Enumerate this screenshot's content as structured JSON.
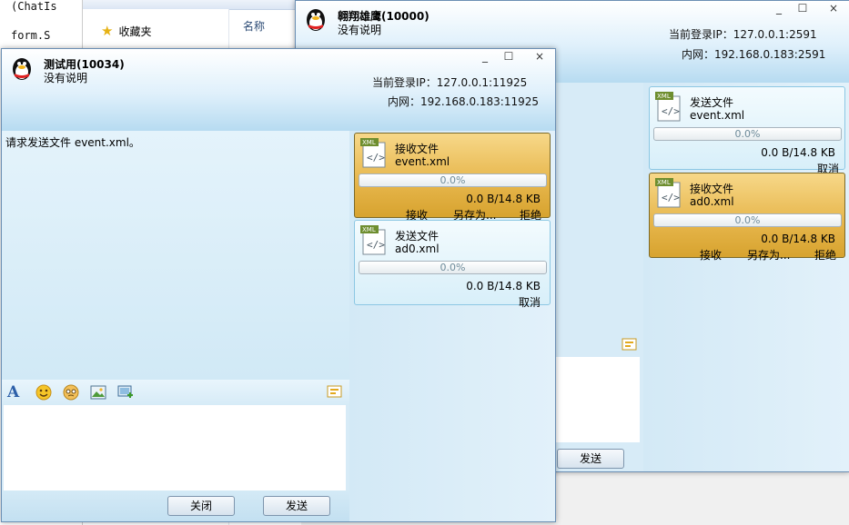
{
  "background": {
    "code_lines": [
      "(ChatIs",
      "form.S"
    ],
    "explorer": {
      "favorites_label": "收藏夹",
      "column_header": "名称"
    }
  },
  "window_back": {
    "title": "翱翔雄鹰(10000)",
    "subtitle": "没有说明",
    "ip_line": "当前登录IP：127.0.0.1:2591",
    "lan_line": "内网：192.168.0.183:2591",
    "buttons": {
      "minimize": "_",
      "maximize": "☐",
      "close": "×"
    },
    "send_button": "发送",
    "transfers": [
      {
        "kind": "send",
        "title": "发送文件",
        "filename": "event.xml",
        "progress": "0.0%",
        "size": "0.0 B/14.8 KB",
        "actions": [
          "取消"
        ]
      },
      {
        "kind": "recv",
        "title": "接收文件",
        "filename": "ad0.xml",
        "progress": "0.0%",
        "size": "0.0 B/14.8 KB",
        "actions": [
          "接收",
          "另存为...",
          "拒绝"
        ]
      }
    ]
  },
  "window_front": {
    "title": "测试用(10034)",
    "subtitle": "没有说明",
    "ip_line": "当前登录IP：127.0.0.1:11925",
    "lan_line": "内网：192.168.0.183:11925",
    "buttons": {
      "minimize": "_",
      "maximize": "☐",
      "close": "×"
    },
    "message": "请求发送文件 event.xml。",
    "transfers": [
      {
        "kind": "recv",
        "title": "接收文件",
        "filename": "event.xml",
        "progress": "0.0%",
        "size": "0.0 B/14.8 KB",
        "actions": [
          "接收",
          "另存为...",
          "拒绝"
        ]
      },
      {
        "kind": "send",
        "title": "发送文件",
        "filename": "ad0.xml",
        "progress": "0.0%",
        "size": "0.0 B/14.8 KB",
        "actions": [
          "取消"
        ]
      }
    ],
    "toolbar_icons": [
      "font-icon",
      "emoji-icon",
      "sticker-icon",
      "image-icon",
      "screenshot-icon",
      "history-icon"
    ],
    "input_value": "",
    "close_button": "关闭",
    "send_button": "发送"
  },
  "colors": {
    "window_border": "#6b8fb4",
    "recv_card": "#e6b54a",
    "send_card": "#d8eff9"
  }
}
